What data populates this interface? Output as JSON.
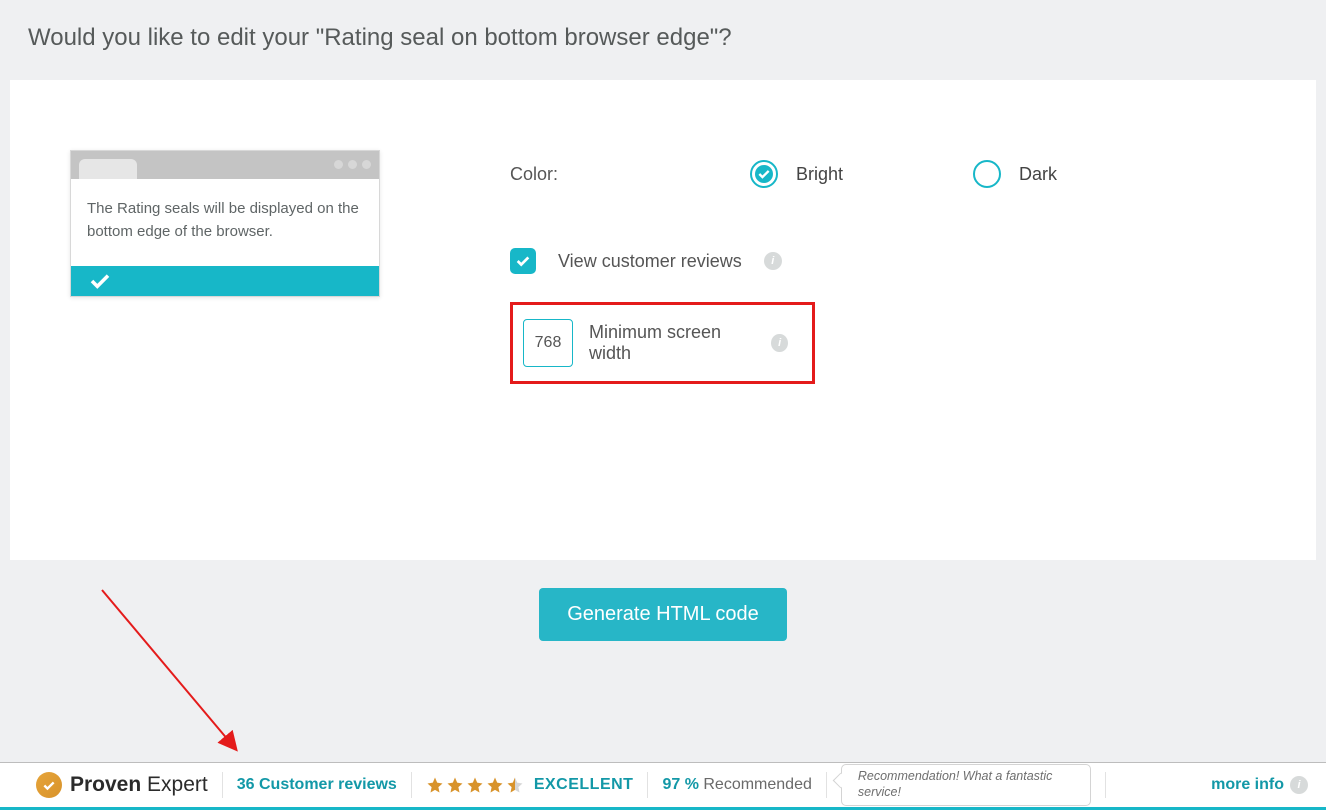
{
  "header": {
    "title": "Would you like to edit your \"Rating seal on bottom browser edge\"?"
  },
  "preview": {
    "text": "The Rating seals will be displayed on the bottom edge of the browser."
  },
  "settings": {
    "color_label": "Color:",
    "option_bright": "Bright",
    "option_dark": "Dark",
    "view_reviews_label": "View customer reviews",
    "min_width_value": "768",
    "min_width_label": "Minimum screen width"
  },
  "action": {
    "generate_label": "Generate HTML code"
  },
  "bar": {
    "brand_bold": "Proven",
    "brand_light": "Expert",
    "reviews": "36 Customer reviews",
    "excellent": "EXCELLENT",
    "recommended_pct": "97 %",
    "recommended_text": "Recommended",
    "speech": "Recommendation! What a fantastic service!",
    "more": "more info"
  }
}
